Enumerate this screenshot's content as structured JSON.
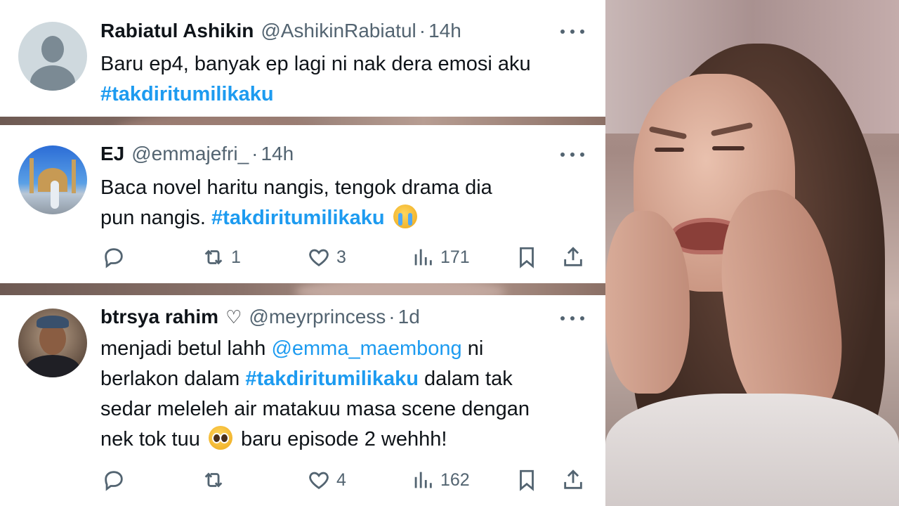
{
  "tweets": [
    {
      "name": "Rabiatul Ashikin",
      "handle": "@AshikinRabiatul",
      "time": "14h",
      "text": "Baru ep4, banyak ep lagi ni nak dera emosi aku",
      "hashtag": "#takdiritumilikaku"
    },
    {
      "name": "EJ",
      "handle": "@emmajefri_",
      "time": "14h",
      "text_line1": "Baca novel haritu nangis, tengok drama dia",
      "text_line2": "pun nangis.",
      "hashtag": "#takdiritumilikaku",
      "emoji": "loudly-crying-face",
      "reply_count": "",
      "retweet_count": "1",
      "like_count": "3",
      "view_count": "171"
    },
    {
      "name": "btrsya rahim",
      "name_symbol": "♡",
      "handle": "@meyrprincess",
      "time": "1d",
      "text_a": "menjadi betul lahh",
      "mention": "@emma_maembong",
      "text_b": "ni",
      "text_c": "berlakon dalam",
      "hashtag": "#takdiritumilikaku",
      "text_d": "dalam tak",
      "text_e": "sedar meleleh air matakuu masa scene dengan",
      "text_f": "nek tok tuu",
      "emoji": "pleading-face",
      "text_g": "baru episode 2 wehhh!",
      "reply_count": "",
      "retweet_count": "",
      "like_count": "4",
      "view_count": "162"
    }
  ],
  "dot_separator": "·",
  "colors": {
    "link": "#1d9bf0",
    "text": "#0f1419",
    "secondary": "#536471",
    "card_bg": "#ffffff"
  },
  "icons": [
    "more-icon",
    "reply-icon",
    "retweet-icon",
    "like-icon",
    "views-icon",
    "bookmark-icon",
    "share-icon"
  ]
}
